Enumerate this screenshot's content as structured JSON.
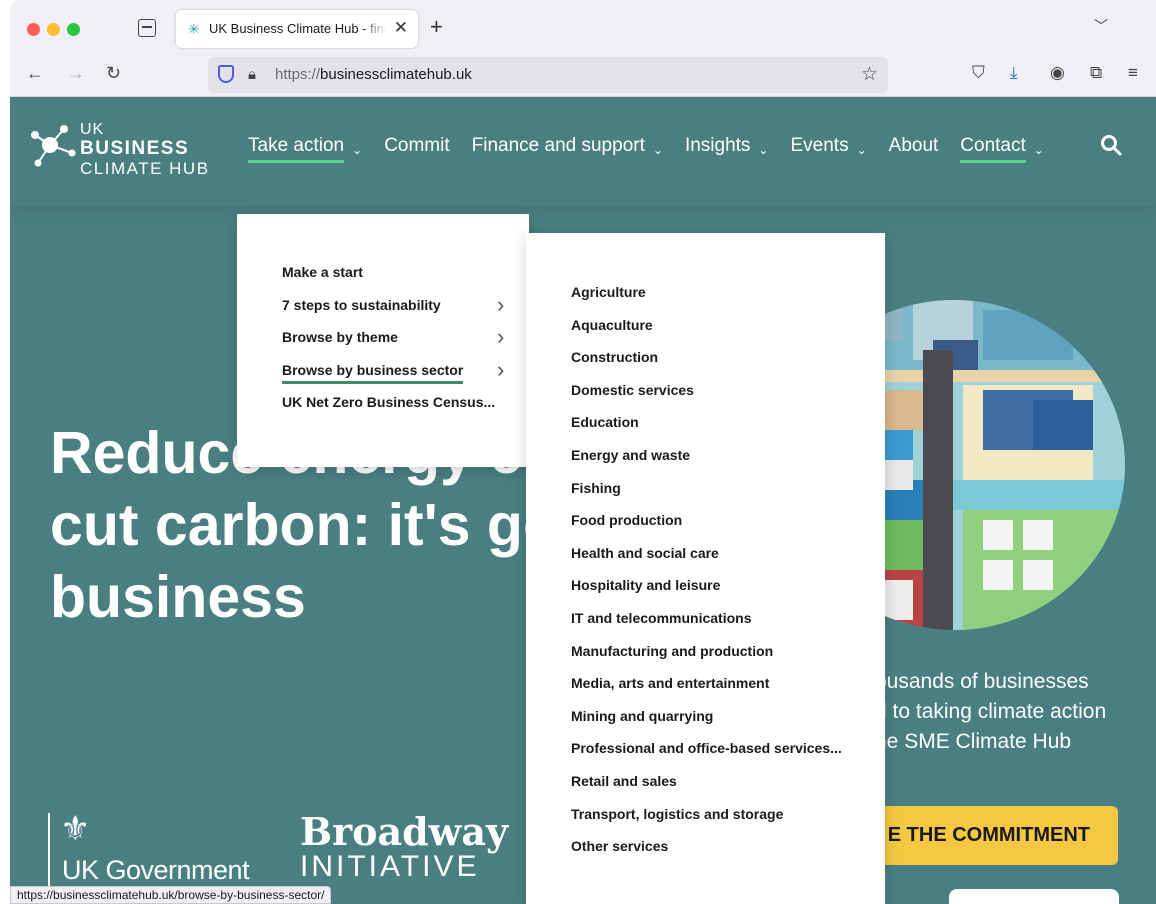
{
  "browser": {
    "tab_title": "UK Business Climate Hub - find",
    "url_protocol": "https://",
    "url_host": "businessclimatehub.uk",
    "status_url": "https://businessclimatehub.uk/browse-by-business-sector/"
  },
  "site": {
    "logo": {
      "line1": "UK",
      "line2": "BUSINESS",
      "line3": "CLIMATE HUB"
    },
    "nav": [
      {
        "label": "Take action",
        "chevron": true,
        "underline": true
      },
      {
        "label": "Commit",
        "chevron": false,
        "underline": false
      },
      {
        "label": "Finance and support",
        "chevron": true,
        "underline": false
      },
      {
        "label": "Insights",
        "chevron": true,
        "underline": false
      },
      {
        "label": "Events",
        "chevron": true,
        "underline": false
      },
      {
        "label": "About",
        "chevron": false,
        "underline": false
      },
      {
        "label": "Contact",
        "chevron": true,
        "underline": true
      }
    ],
    "hero_lines": [
      "Reduce energy co",
      "cut carbon: it's go",
      "business"
    ],
    "side_text": [
      "ousands of businesses",
      "d to taking climate action",
      "he SME Climate Hub"
    ],
    "commit_button": "E THE COMMITMENT",
    "gov_logo_text": "UK Government",
    "broadway_line1": "Broadway",
    "broadway_line2": "INITIATIVE"
  },
  "menu_primary": [
    {
      "label": "Make a start",
      "has_submenu": false,
      "active": false
    },
    {
      "label": "7 steps to sustainability",
      "has_submenu": true,
      "active": false
    },
    {
      "label": "Browse by theme",
      "has_submenu": true,
      "active": false
    },
    {
      "label": "Browse by business sector",
      "has_submenu": true,
      "active": true
    },
    {
      "label": "UK Net Zero Business Census...",
      "has_submenu": false,
      "active": false
    }
  ],
  "menu_sectors": [
    "Agriculture",
    "Aquaculture",
    "Construction",
    "Domestic services",
    "Education",
    "Energy and waste",
    "Fishing",
    "Food production",
    "Health and social care",
    "Hospitality and leisure",
    "IT and telecommunications",
    "Manufacturing and production",
    "Media, arts and entertainment",
    "Mining and quarrying",
    "Professional and office-based services...",
    "Retail and sales",
    "Transport, logistics and storage",
    "Other services"
  ],
  "colors": {
    "site_bg": "#4a7f82",
    "nav_underline": "#58d38b",
    "menu_active_underline": "#3a8f65",
    "commit_button": "#f4c842"
  }
}
